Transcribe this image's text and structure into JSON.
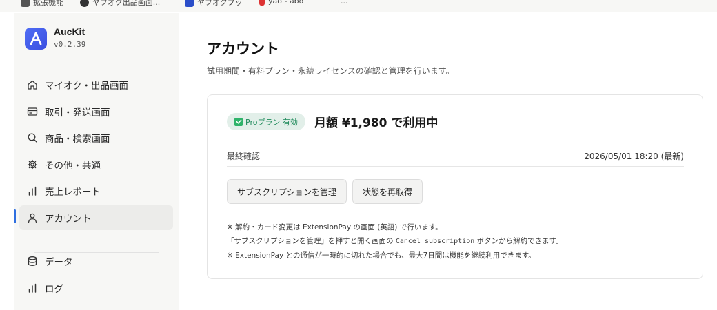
{
  "bookmarks": [
    {
      "label": "拡張機能"
    },
    {
      "label": "ヤフオク出品画面..."
    },
    {
      "label": "ヤフオクブッ"
    },
    {
      "label": "yao - abd"
    },
    {
      "label": "..."
    }
  ],
  "sidebar": {
    "app_name": "AucKit",
    "version": "v0.2.39",
    "logo_letter": "A",
    "items": [
      {
        "label": "マイオク・出品画面",
        "icon": "home-icon"
      },
      {
        "label": "取引・発送画面",
        "icon": "card-icon"
      },
      {
        "label": "商品・検索画面",
        "icon": "search-icon"
      },
      {
        "label": "その他・共通",
        "icon": "gear-icon"
      },
      {
        "label": "売上レポート",
        "icon": "bar-chart-icon"
      },
      {
        "label": "アカウント",
        "icon": "user-icon",
        "active": true
      }
    ],
    "items2": [
      {
        "label": "データ",
        "icon": "database-icon"
      },
      {
        "label": "ログ",
        "icon": "bar-chart-icon"
      }
    ]
  },
  "main": {
    "title": "アカウント",
    "subtitle": "試用期間・有料プラン・永続ライセンスの確認と管理を行います。",
    "card": {
      "badge": "Proプラン 有効",
      "price": "月額 ¥1,980 で利用中",
      "last_checked_label": "最終確認",
      "last_checked_value": "2026/05/01 18:20 (最新)",
      "manage_button": "サブスクリプションを管理",
      "refresh_button": "状態を再取得",
      "note1": "※ 解約・カード変更は ExtensionPay の画面 (英語) で行います。",
      "note2_a": "「サブスクリプションを管理」を押すと開く画面の ",
      "note2_code": "Cancel subscription",
      "note2_b": " ボタンから解約できます。",
      "note3": "※ ExtensionPay との通信が一時的に切れた場合でも、最大7日間は機能を継続利用できます。"
    }
  },
  "colors": {
    "accent": "#2f6fe0",
    "logo": "#4f6df5",
    "badge_bg": "#e2efe9",
    "badge_text": "#1e8a5a"
  }
}
